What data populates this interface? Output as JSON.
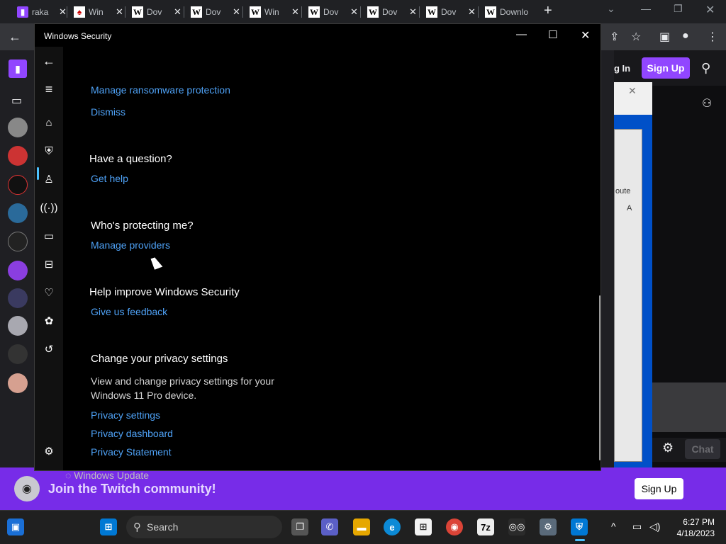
{
  "browser": {
    "tabs": [
      {
        "label": "raka",
        "favicon": "twitch"
      },
      {
        "label": "Win",
        "favicon": "windows-security"
      },
      {
        "label": "Dov",
        "favicon": "W"
      },
      {
        "label": "Dov",
        "favicon": "W"
      },
      {
        "label": "Win",
        "favicon": "W"
      },
      {
        "label": "Dov",
        "favicon": "W"
      },
      {
        "label": "Dov",
        "favicon": "W"
      },
      {
        "label": "Dov",
        "favicon": "W"
      },
      {
        "label": "Downlo",
        "favicon": "W"
      }
    ],
    "tab_close": "✕",
    "new_tab": "+"
  },
  "twitch": {
    "login": "g In",
    "signup": "Sign Up",
    "chat": "Chat",
    "banner_text": "Join the Twitch community!",
    "banner_signup": "Sign Up",
    "brand_color": "#9146ff",
    "bg_dialog_text": [
      "oute",
      "A"
    ]
  },
  "security_window": {
    "title": "Windows Security",
    "links_top": [
      "Manage ransomware protection",
      "Dismiss"
    ],
    "sections": [
      {
        "heading": "Have a question?",
        "links": [
          "Get help"
        ]
      },
      {
        "heading": "Who's protecting me?",
        "links": [
          "Manage providers"
        ]
      },
      {
        "heading": "Help improve Windows Security",
        "links": [
          "Give us feedback"
        ]
      },
      {
        "heading": "Change your privacy settings",
        "description": "View and change privacy settings for your Windows 11 Pro device.",
        "links": [
          "Privacy settings",
          "Privacy dashboard",
          "Privacy Statement"
        ]
      }
    ],
    "nav_icons": [
      "back-icon",
      "menu-icon",
      "home-icon",
      "shield-icon",
      "account-icon",
      "firewall-icon",
      "app-browser-icon",
      "device-security-icon",
      "health-icon",
      "family-icon",
      "history-icon",
      "settings-icon"
    ],
    "link_color": "#4ea1f5"
  },
  "background_window": {
    "text": "Windows Update"
  },
  "taskbar": {
    "search_label": "Search",
    "time": "6:27 PM",
    "date": "4/18/2023",
    "apps": [
      "start",
      "search",
      "task-view",
      "teams",
      "file-explorer",
      "edge",
      "store",
      "chrome",
      "7zip",
      "app",
      "settings",
      "windows-security"
    ]
  }
}
